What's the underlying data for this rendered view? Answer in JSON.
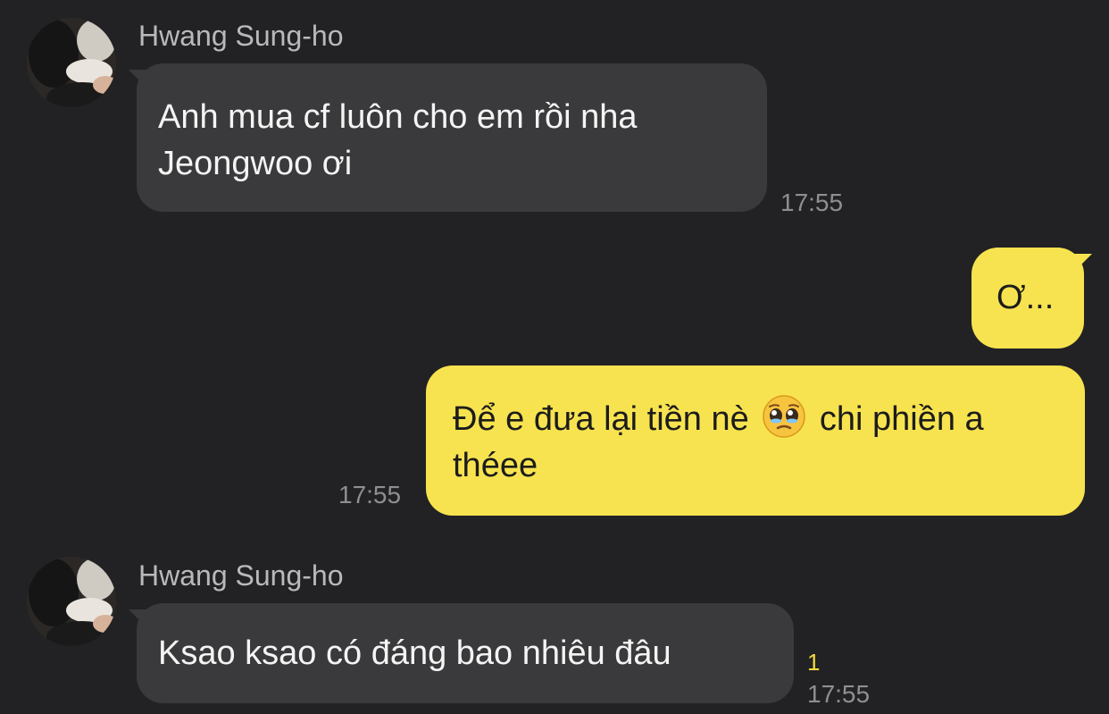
{
  "messages": [
    {
      "sender": "Hwang Sung-ho",
      "text": "Anh mua cf luôn cho em rồi nha Jeongwoo ơi",
      "time": "17:55"
    },
    {
      "text": "Ơ...",
      "time": ""
    },
    {
      "text_before_emoji": "Để e đưa lại tiền nè",
      "emoji": "pleading-face-emoji",
      "text_after_emoji": "chi phiền a théee",
      "time": "17:55"
    },
    {
      "sender": "Hwang Sung-ho",
      "text": "Ksao ksao có đáng bao nhiêu đâu",
      "unread_count": "1",
      "time": "17:55"
    }
  ],
  "colors": {
    "background": "#222224",
    "incoming_bubble": "#3a3a3c",
    "outgoing_bubble": "#f7e34f",
    "unread": "#f3da3b"
  }
}
